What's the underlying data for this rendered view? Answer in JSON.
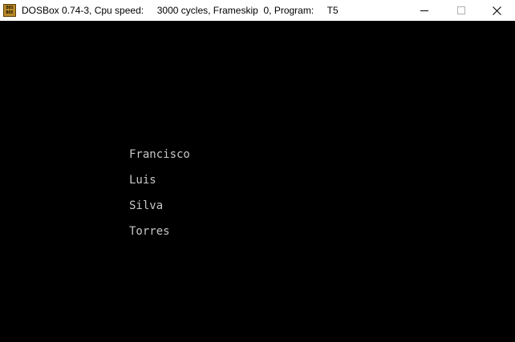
{
  "window": {
    "title": "DOSBox 0.74-3, Cpu speed:     3000 cycles, Frameskip  0, Program:     T5",
    "icon": "dosbox-icon",
    "icon_text_top": "DOS",
    "icon_text_bottom": "BOX"
  },
  "controls": {
    "minimize_icon": "minimize-icon",
    "maximize_icon": "maximize-icon",
    "close_icon": "close-icon"
  },
  "screen": {
    "lines": [
      "Francisco",
      "Luis",
      "Silva",
      "Torres"
    ],
    "text_color": "#c7c7c7",
    "background": "#000000"
  }
}
